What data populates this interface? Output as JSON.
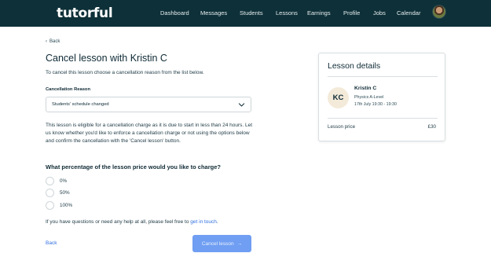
{
  "header": {
    "logo": "tutorful",
    "nav": [
      {
        "label": "Dashboard"
      },
      {
        "label": "Messages"
      },
      {
        "label": "Students"
      },
      {
        "label": "Lessons"
      },
      {
        "label": "Earnings"
      },
      {
        "label": "Profile"
      },
      {
        "label": "Jobs"
      },
      {
        "label": "Calendar"
      }
    ]
  },
  "main": {
    "back_link": "Back",
    "title": "Cancel lesson with Kristin C",
    "subtitle": "To cancel this lesson choose a cancellation reason from the list below.",
    "reason_label": "Cancellation Reason",
    "reason_value": "Students' schedule changed",
    "notice": "This lesson is eligible for a cancellation charge as it is due to start in less than 24 hours. Let us know whether you'd like to enforce a cancellation charge or not using the options below and confirm the cancellation with the 'Cancel lesson' button.",
    "question": "What percentage of the lesson price would you like to charge?",
    "options": [
      {
        "label": "0%"
      },
      {
        "label": "50%"
      },
      {
        "label": "100%"
      }
    ],
    "help_text": "If you have questions or need any help at all, please feel free to",
    "help_link": "get in touch",
    "help_end": ".",
    "back_button": "Back",
    "cancel_button": "Cancel lesson",
    "cancel_arrow": "→"
  },
  "card": {
    "title": "Lesson details",
    "initials": "KC",
    "name": "Kristin C",
    "subject": "Physics A-Level",
    "time": "17th July 19:30 - 19:30",
    "price_label": "Lesson price",
    "price_value": "£30"
  },
  "colors": {
    "header_bg": "#0e3038",
    "link": "#2f6fe0",
    "button_disabled": "#6f9ef2",
    "initials_bg": "#f4ead9"
  }
}
